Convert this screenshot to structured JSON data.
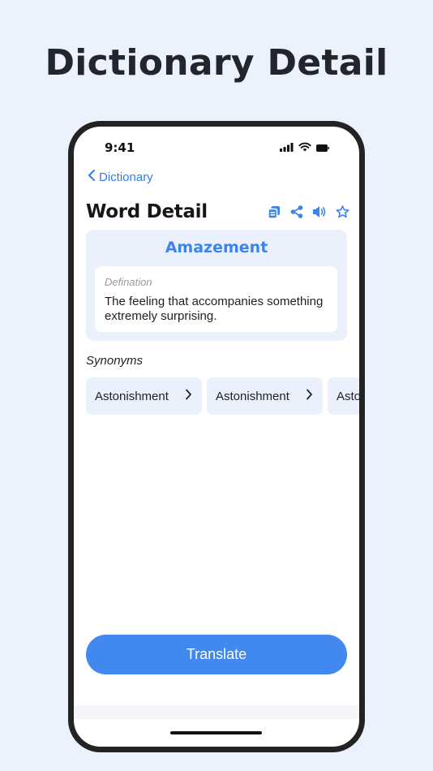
{
  "promo": {
    "title": "Dictionary Detail"
  },
  "status_bar": {
    "time": "9:41",
    "icons": [
      "cellular-signal-icon",
      "wifi-icon",
      "battery-icon"
    ]
  },
  "nav": {
    "back_label": "Dictionary",
    "back_icon": "chevron-left-icon"
  },
  "header": {
    "title": "Word Detail",
    "actions": [
      "copy-icon",
      "share-icon",
      "speaker-icon",
      "star-icon"
    ]
  },
  "word": {
    "term": "Amazement",
    "definition_label": "Defination",
    "definition": "The feeling that accompanies something extremely surprising."
  },
  "synonyms": {
    "heading": "Synonyms",
    "items": [
      "Astonishment",
      "Astonishment",
      "Astonishment"
    ]
  },
  "actions": {
    "translate_label": "Translate"
  },
  "colors": {
    "accent": "#4189ee",
    "link": "#2f7ff0",
    "card_bg": "#eaf1fd",
    "page_bg": "#ecf2fd"
  }
}
